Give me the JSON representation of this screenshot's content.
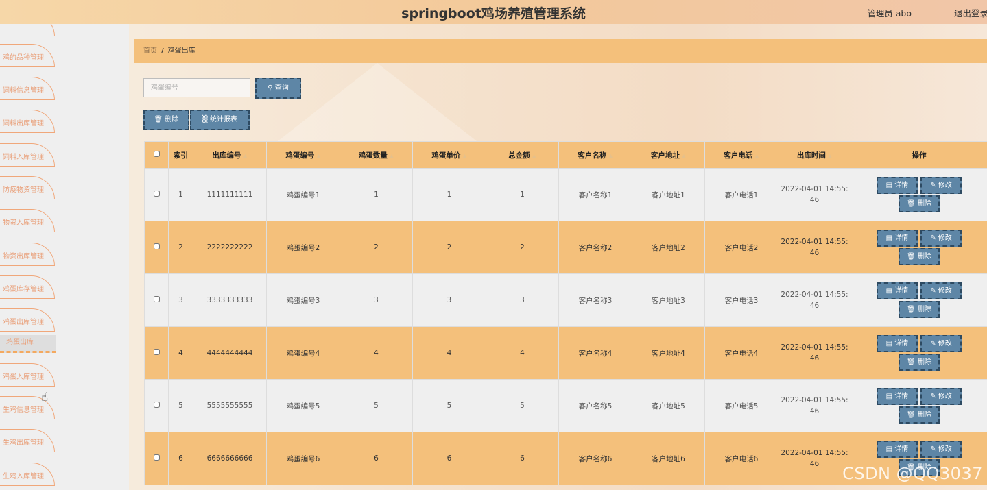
{
  "header": {
    "title": "springboot鸡场养殖管理系统",
    "user": "管理员 abo",
    "logout": "退出登录"
  },
  "sidebar": {
    "items": [
      {
        "label": "鸡的品种管理"
      },
      {
        "label": "饲料信息管理"
      },
      {
        "label": "饲料出库管理"
      },
      {
        "label": "饲料入库管理"
      },
      {
        "label": "防疫物资管理"
      },
      {
        "label": "物资入库管理"
      },
      {
        "label": "物资出库管理"
      },
      {
        "label": "鸡蛋库存管理"
      },
      {
        "label": "鸡蛋出库管理"
      },
      {
        "label": "鸡蛋入库管理"
      },
      {
        "label": "生鸡信息管理"
      },
      {
        "label": "生鸡出库管理"
      },
      {
        "label": "生鸡入库管理"
      }
    ],
    "active_sub": "鸡蛋出库"
  },
  "breadcrumb": {
    "home": "首页",
    "separator": "/",
    "current": "鸡蛋出库"
  },
  "search": {
    "placeholder": "鸡蛋编号",
    "query_label": "查询"
  },
  "toolbar": {
    "delete_label": "删除",
    "stats_label": "统计报表"
  },
  "table": {
    "columns": [
      "索引",
      "出库编号",
      "鸡蛋编号",
      "鸡蛋数量",
      "鸡蛋单价",
      "总金额",
      "客户名称",
      "客户地址",
      "客户电话",
      "出库时间",
      "操作"
    ],
    "rows": [
      {
        "index": "1",
        "out_no": "1111111111",
        "egg_no": "鸡蛋编号1",
        "qty": "1",
        "price": "1",
        "total": "1",
        "customer": "客户名称1",
        "address": "客户地址1",
        "phone": "客户电话1",
        "time_a": "2022-04-01 14:55:",
        "time_b": "46"
      },
      {
        "index": "2",
        "out_no": "2222222222",
        "egg_no": "鸡蛋编号2",
        "qty": "2",
        "price": "2",
        "total": "2",
        "customer": "客户名称2",
        "address": "客户地址2",
        "phone": "客户电话2",
        "time_a": "2022-04-01 14:55:",
        "time_b": "46"
      },
      {
        "index": "3",
        "out_no": "3333333333",
        "egg_no": "鸡蛋编号3",
        "qty": "3",
        "price": "3",
        "total": "3",
        "customer": "客户名称3",
        "address": "客户地址3",
        "phone": "客户电话3",
        "time_a": "2022-04-01 14:55:",
        "time_b": "46"
      },
      {
        "index": "4",
        "out_no": "4444444444",
        "egg_no": "鸡蛋编号4",
        "qty": "4",
        "price": "4",
        "total": "4",
        "customer": "客户名称4",
        "address": "客户地址4",
        "phone": "客户电话4",
        "time_a": "2022-04-01 14:55:",
        "time_b": "46"
      },
      {
        "index": "5",
        "out_no": "5555555555",
        "egg_no": "鸡蛋编号5",
        "qty": "5",
        "price": "5",
        "total": "5",
        "customer": "客户名称5",
        "address": "客户地址5",
        "phone": "客户电话5",
        "time_a": "2022-04-01 14:55:",
        "time_b": "46"
      },
      {
        "index": "6",
        "out_no": "6666666666",
        "egg_no": "鸡蛋编号6",
        "qty": "6",
        "price": "6",
        "total": "6",
        "customer": "客户名称6",
        "address": "客户地址6",
        "phone": "客户电话6",
        "time_a": "2022-04-01 14:55:",
        "time_b": "46"
      }
    ],
    "actions": {
      "detail": "详情",
      "edit": "修改",
      "delete": "删除"
    }
  },
  "watermark": "CSDN @QQ3037",
  "colors": {
    "accent": "#f4c07b",
    "button": "#5e86a6",
    "menu_text": "#e9a07a"
  }
}
